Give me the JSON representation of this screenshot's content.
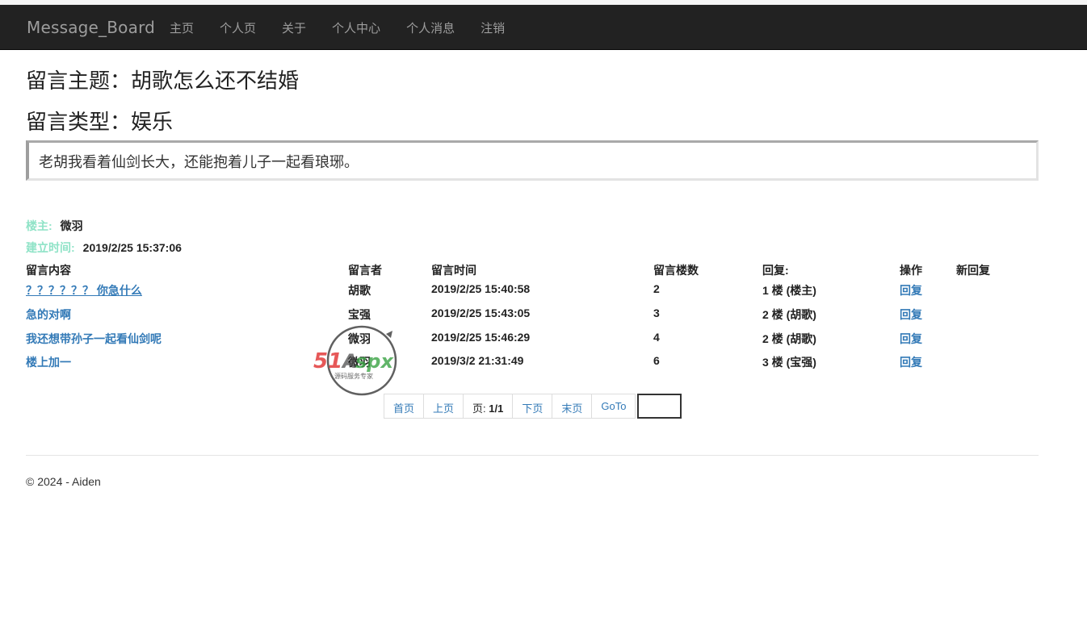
{
  "app": {
    "brand": "Message_Board",
    "nav": [
      "主页",
      "个人页",
      "关于",
      "个人中心",
      "个人消息",
      "注销"
    ]
  },
  "message": {
    "topic": "留言主题：胡歌怎么还不结婚",
    "type": "留言类型：娱乐",
    "content": "老胡我看着仙剑长大，还能抱着儿子一起看琅琊。",
    "owner_label": "楼主:",
    "owner": "微羽",
    "created_label": "建立时间:",
    "created": "2019/2/25 15:37:06"
  },
  "replies": {
    "headers": {
      "content": "留言内容",
      "author": "留言者",
      "time": "留言时间",
      "floor": "留言楼数",
      "reply_to": "回复:",
      "action": "操作",
      "new_reply": "新回复"
    },
    "rows": [
      {
        "content": "？？？？？？ 你急什么",
        "author": "胡歌",
        "time": "2019/2/25 15:40:58",
        "floor": "2",
        "reply_to": "1 楼 (楼主)",
        "action": "回复"
      },
      {
        "content": "急的对啊",
        "author": "宝强",
        "time": "2019/2/25 15:43:05",
        "floor": "3",
        "reply_to": "2 楼 (胡歌)",
        "action": "回复"
      },
      {
        "content": "我还想带孙子一起看仙剑呢",
        "author": "微羽",
        "time": "2019/2/25 15:46:29",
        "floor": "4",
        "reply_to": "2 楼 (胡歌)",
        "action": "回复"
      },
      {
        "content": "楼上加一",
        "author": "微羽",
        "time": "2019/3/2 21:31:49",
        "floor": "6",
        "reply_to": "3 楼 (宝强)",
        "action": "回复"
      }
    ]
  },
  "pager": {
    "first": "首页",
    "prev": "上页",
    "page_label": "页: ",
    "page_value": "1/1",
    "next": "下页",
    "last": "末页",
    "goto": "GoTo",
    "goto_value": ""
  },
  "watermark": {
    "text": "51ASPX",
    "subtext": "源码服务专家"
  },
  "footer": "© 2024 - Aiden",
  "colors": {
    "navbar": "#222222",
    "nav_text": "#9d9d9d",
    "link": "#337ab7",
    "meta_label": "#8fe3c7"
  }
}
